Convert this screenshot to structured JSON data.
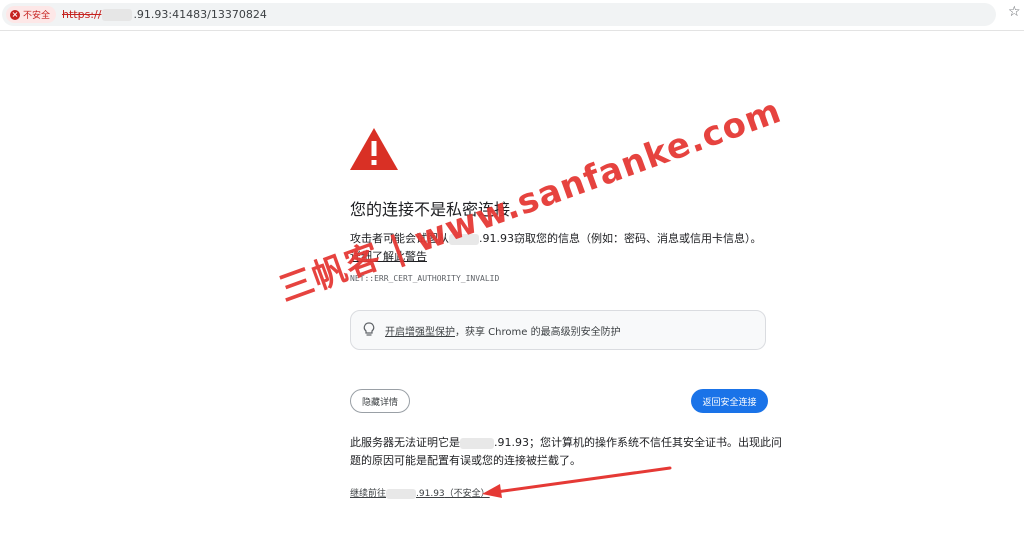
{
  "browser": {
    "security_chip": "不安全",
    "url_scheme": "https://",
    "url_rest": ".91.93:41483/13370824"
  },
  "page": {
    "title": "您的连接不是私密连接",
    "desc_part1": "攻击者可能会试图从",
    "desc_host": ".91.93",
    "desc_part2": "窃取您的信息（例如：密码、消息或信用卡信息）。",
    "learn_more": "详细了解此警告",
    "error_code": "NET::ERR_CERT_AUTHORITY_INVALID",
    "enhanced_link": "开启增强型保护",
    "enhanced_text": "，获享 Chrome 的最高级别安全防护",
    "hide_details_button": "隐藏详情",
    "back_button": "返回安全连接",
    "explain_part1": "此服务器无法证明它是",
    "explain_host": ".91.93",
    "explain_part2": "；您计算机的操作系统不信任其安全证书。出现此问题的原因可能是配置有误或您的连接被拦截了。",
    "proceed_part1": "继续前往",
    "proceed_host": ".91.93",
    "proceed_part2": "（不安全）"
  },
  "overlay": {
    "watermark": "三帆客 | www.sanfanke.com",
    "arrow_color": "#e53935"
  },
  "colors": {
    "warning_red": "#d93025",
    "primary_blue": "#1a73e8"
  }
}
